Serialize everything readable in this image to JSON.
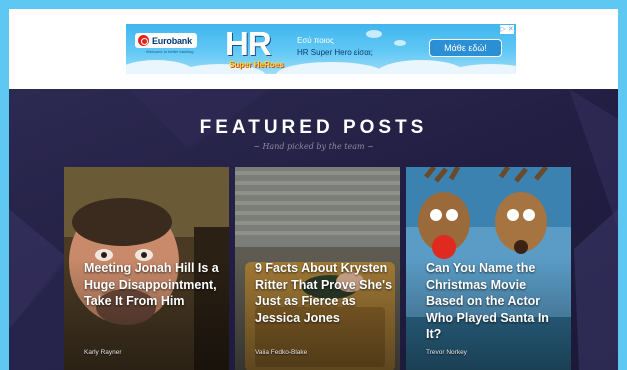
{
  "ad": {
    "bank": "Eurobank",
    "bank_tagline": "Welcome to better banking",
    "brand": "HR",
    "brand_sub": "Super HeRoes",
    "line1": "Εσύ ποιος",
    "line2": "HR Super Hero είσαι;",
    "cta": "Μάθε εδώ!",
    "close": "▷ ✕"
  },
  "featured": {
    "title": "FEATURED POSTS",
    "subtitle": "~ Hand picked by the team ~",
    "posts": [
      {
        "title": "Meeting Jonah Hill Is a Huge Disappointment, Take It From Him",
        "author": "Karly Rayner"
      },
      {
        "title": "9 Facts About Krysten Ritter That Prove She's Just as Fierce as Jessica Jones",
        "author": "Vaiia Fedko-Blake"
      },
      {
        "title": "Can You Name the Christmas Movie Based on the Actor Who Played Santa In It?",
        "author": "Trevor Norkey"
      }
    ]
  },
  "colors": {
    "page_bg": "#5ec8f2",
    "section_bg": "#2d2a52",
    "ad_cta": "#2a8fd4",
    "eurobank_red": "#e2231a"
  }
}
